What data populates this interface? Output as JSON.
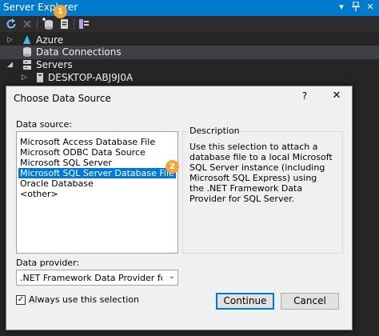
{
  "explorer": {
    "title": "Server Explorer",
    "tree": {
      "azure": "Azure",
      "data_connections": "Data Connections",
      "servers": "Servers",
      "machine": "DESKTOP-ABJ9J0A"
    },
    "callout_1": "1"
  },
  "dialog": {
    "title": "Choose Data Source",
    "help": "?",
    "close": "✕",
    "data_source_label": "Data source:",
    "data_sources": [
      "Microsoft Access Database File",
      "Microsoft ODBC Data Source",
      "Microsoft SQL Server",
      "Microsoft SQL Server Database File",
      "Oracle Database",
      "<other>"
    ],
    "selected_index": 3,
    "callout_2": "2",
    "description_label": "Description",
    "description": "Use this selection to attach a database file to a local Microsoft SQL Server instance (including Microsoft SQL Express) using the .NET Framework Data Provider for SQL Server.",
    "provider_label": "Data provider:",
    "provider_value": ".NET Framework Data Provider for SQ",
    "always_use_label": "Always use this selection",
    "always_use_checked": true,
    "continue_label": "Continue",
    "cancel_label": "Cancel"
  },
  "colors": {
    "title_bar": "#007acc",
    "selection": "#0078d7",
    "callout": "#f2a63a"
  }
}
